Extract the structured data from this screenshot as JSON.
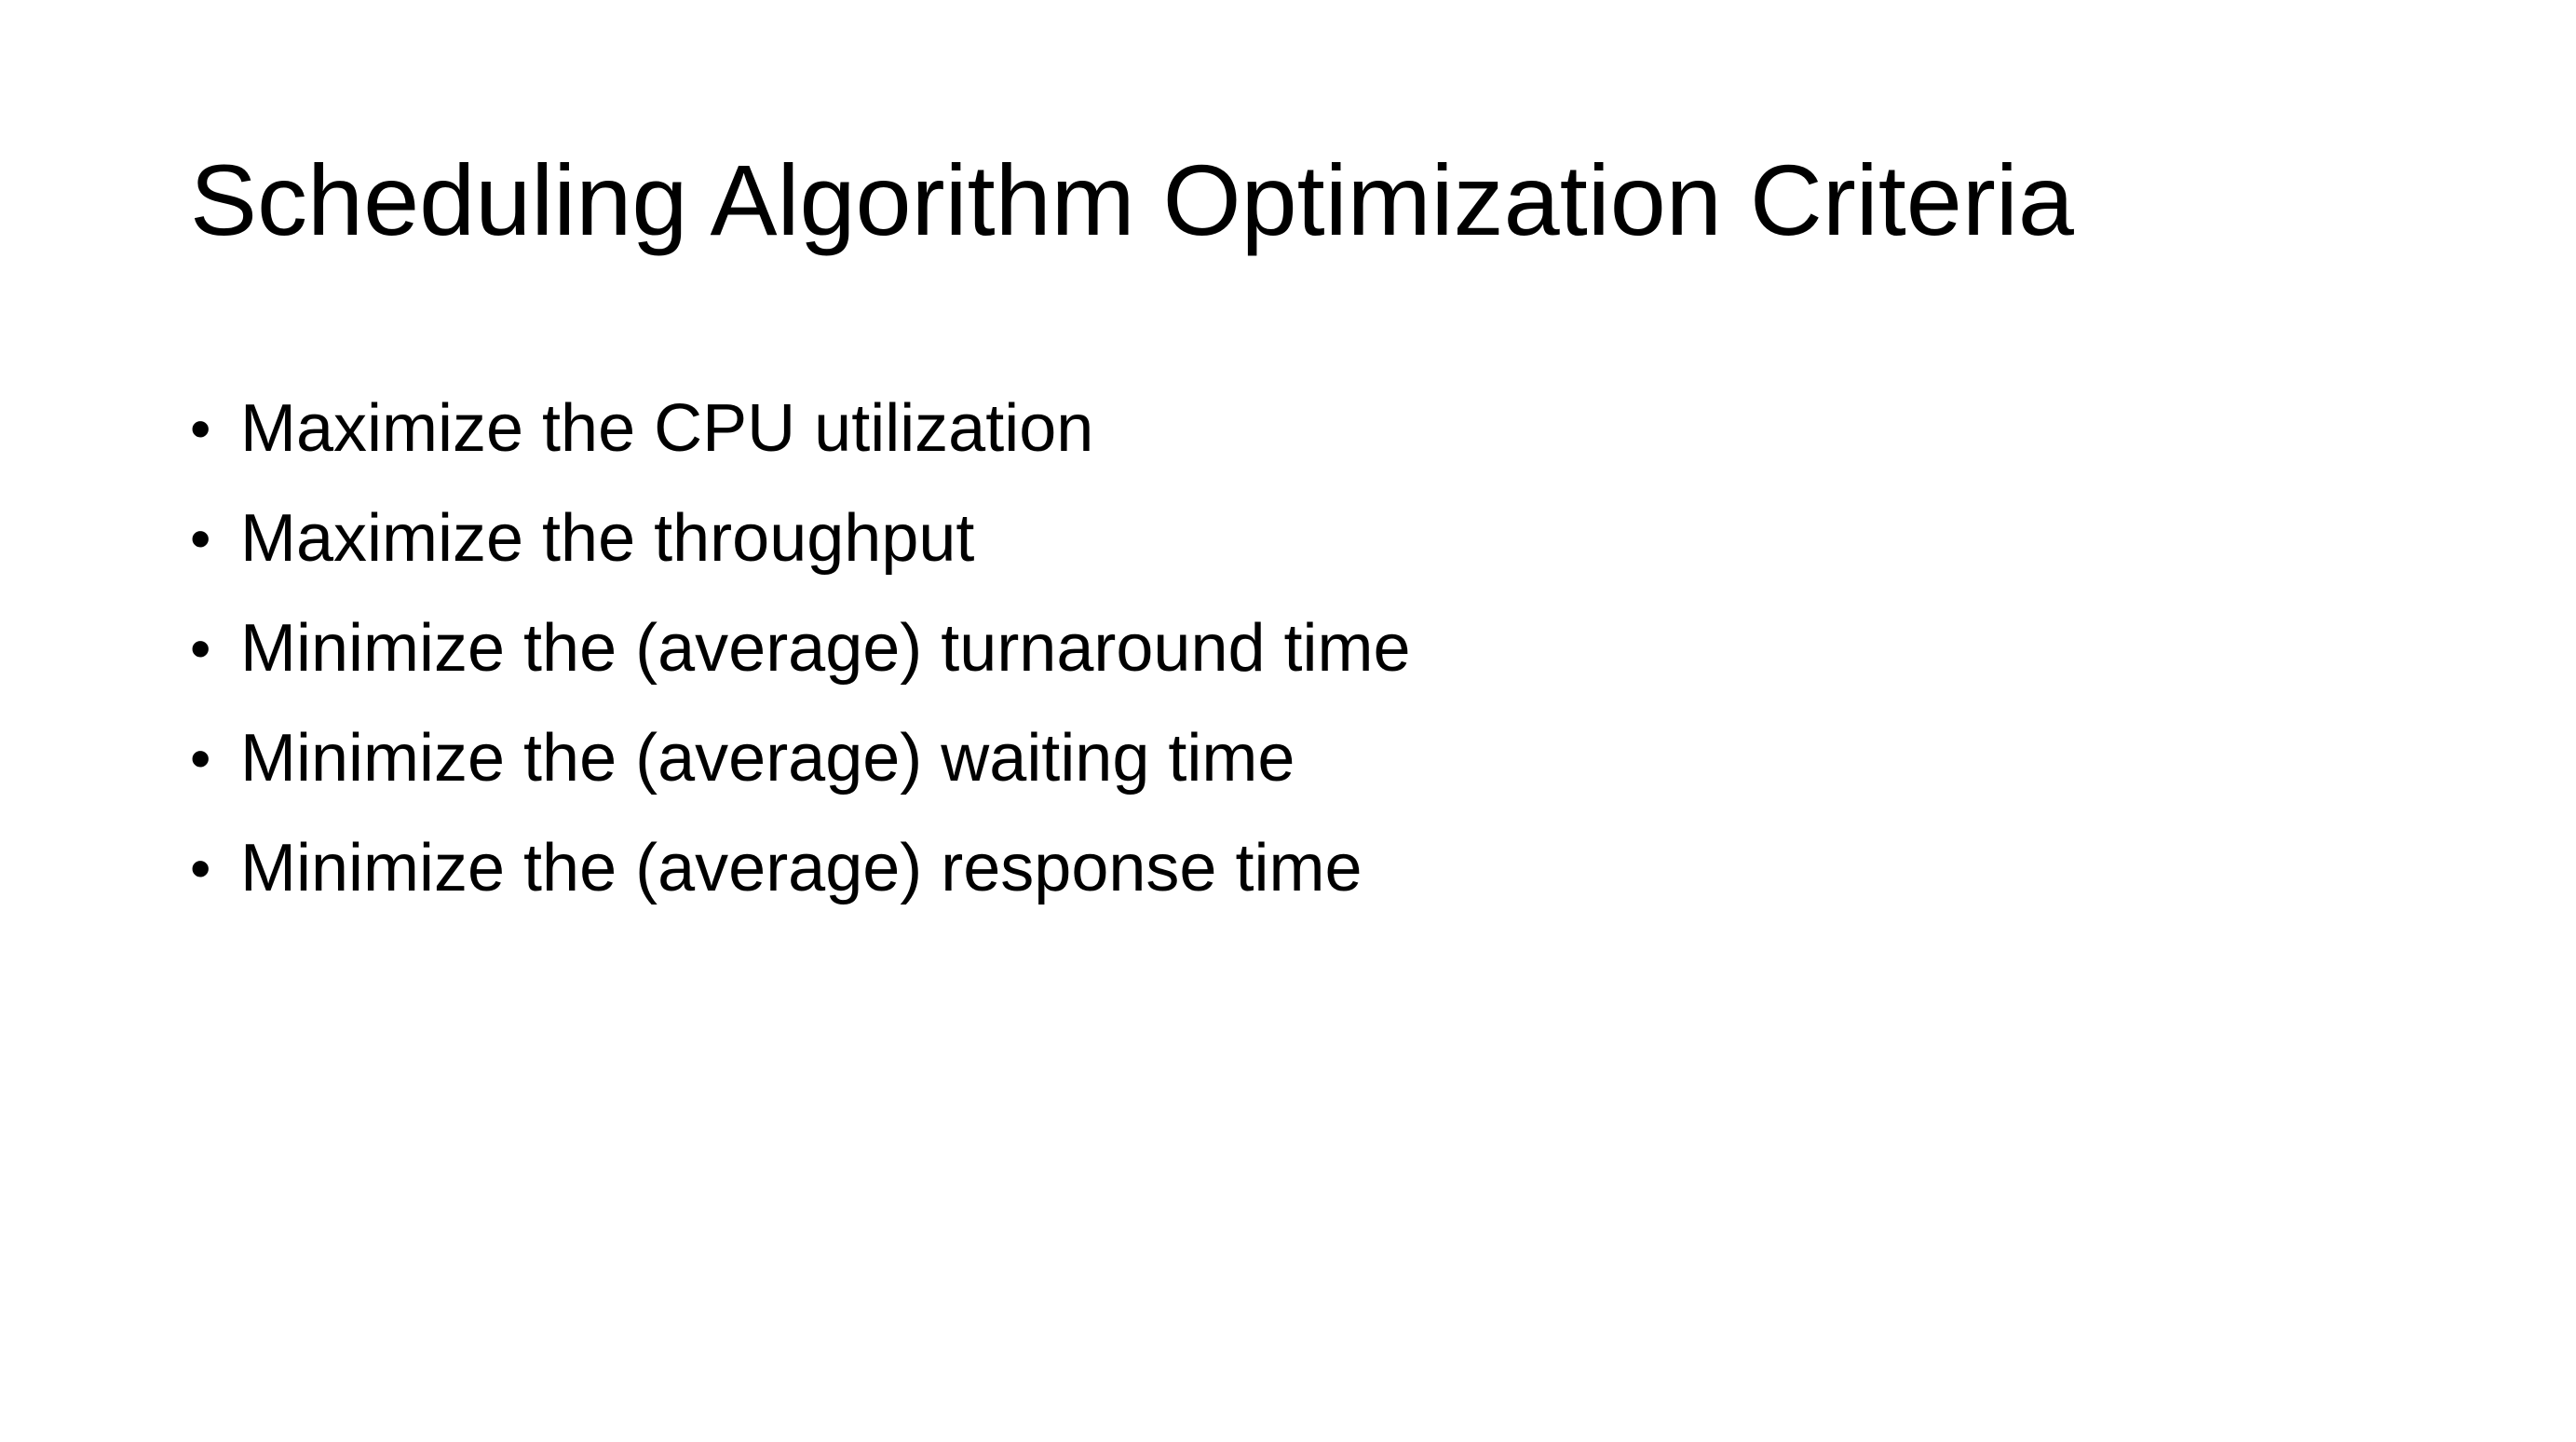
{
  "slide": {
    "title": "Scheduling Algorithm Optimization Criteria",
    "bullets": [
      "Maximize the CPU utilization",
      "Maximize the throughput",
      "Minimize the (average) turnaround time",
      "Minimize the (average) waiting time",
      "Minimize the (average) response time"
    ],
    "bullet_glyph": "•",
    "colors": {
      "background": "#ffffff",
      "text": "#000000"
    }
  }
}
